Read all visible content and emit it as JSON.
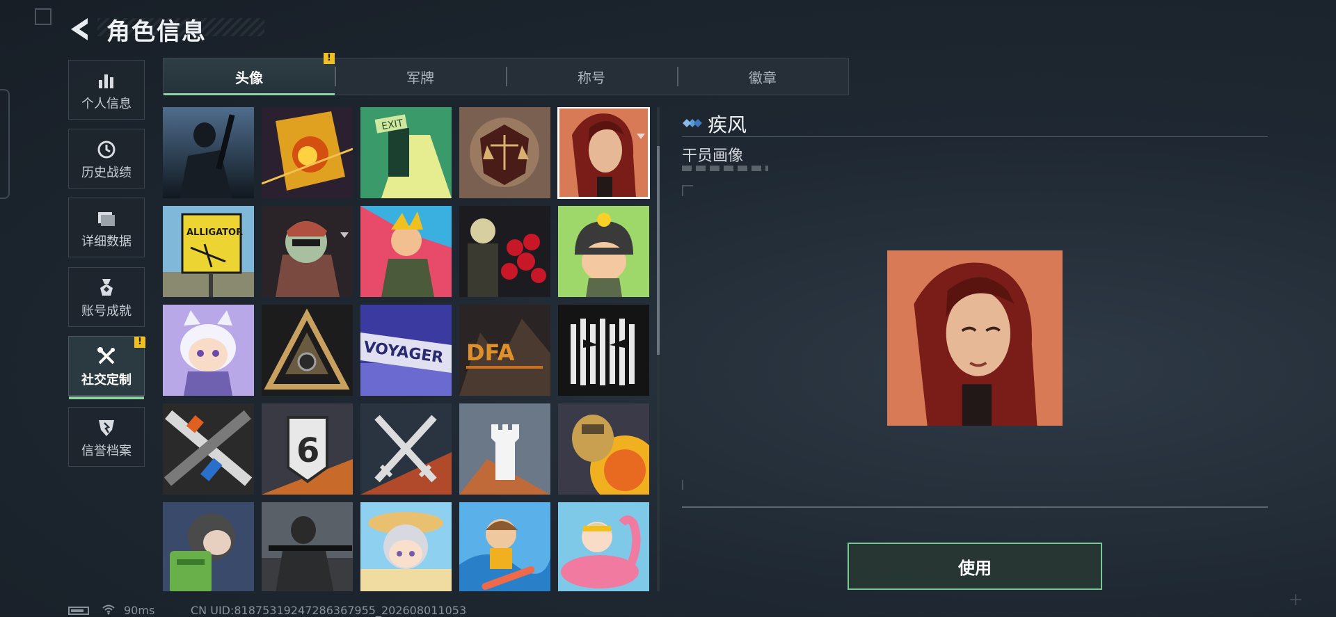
{
  "header": {
    "title": "角色信息"
  },
  "sidebar": {
    "items": [
      {
        "label": "个人信息",
        "icon": "bar-chart-icon"
      },
      {
        "label": "历史战绩",
        "icon": "history-clock-icon"
      },
      {
        "label": "详细数据",
        "icon": "folder-data-icon"
      },
      {
        "label": "账号成就",
        "icon": "achievement-medal-icon"
      },
      {
        "label": "社交定制",
        "icon": "tools-wrench-icon",
        "active": true,
        "alert": "!"
      },
      {
        "label": "信誉档案",
        "icon": "credit-shield-icon"
      }
    ]
  },
  "tabs": [
    {
      "label": "头像",
      "active": true,
      "alert": "!"
    },
    {
      "label": "军牌"
    },
    {
      "label": "称号"
    },
    {
      "label": "徽章"
    }
  ],
  "avatar_grid": {
    "selected_index": 4,
    "items": [
      {
        "name": "soldier-dark-avatar"
      },
      {
        "name": "fire-poster-avatar"
      },
      {
        "name": "exit-door-avatar"
      },
      {
        "name": "scales-emblem-avatar"
      },
      {
        "name": "red-hair-woman-avatar",
        "marker": true
      },
      {
        "name": "alligator-sign-avatar",
        "sign_text": "ALLIGATOR"
      },
      {
        "name": "masked-man-avatar",
        "marker": true
      },
      {
        "name": "cartoon-soldier-colorful-avatar"
      },
      {
        "name": "skull-roses-avatar"
      },
      {
        "name": "chibi-helmet-duck-avatar"
      },
      {
        "name": "cat-girl-chibi-avatar"
      },
      {
        "name": "triangle-emblem-avatar"
      },
      {
        "name": "voyager-graffiti-avatar",
        "sign_text": "VOYAGER"
      },
      {
        "name": "dfa-logo-avatar",
        "sign_text": "DFA"
      },
      {
        "name": "barcode-mask-avatar"
      },
      {
        "name": "crossed-guns-avatar"
      },
      {
        "name": "number-six-shield-avatar",
        "sign_text": "6"
      },
      {
        "name": "crossed-swords-avatar"
      },
      {
        "name": "tower-rook-avatar"
      },
      {
        "name": "golden-armor-avatar"
      },
      {
        "name": "cartoon-backpack-soldier-avatar"
      },
      {
        "name": "sniper-soldier-avatar"
      },
      {
        "name": "beach-girl-chibi-avatar"
      },
      {
        "name": "surfer-boy-chibi-avatar"
      },
      {
        "name": "flamingo-float-chibi-avatar"
      }
    ]
  },
  "detail": {
    "name": "疾风",
    "type": "干员画像",
    "button_label": "使用"
  },
  "status_bar": {
    "ping": "90ms",
    "uid": "CN UID:8187531924728636795​5_202608011053"
  },
  "colors": {
    "accent_green": "#8fd3a4",
    "alert_yellow": "#f0c020",
    "button_border": "#78c896",
    "diamond_blue": "#5b9bd5"
  }
}
